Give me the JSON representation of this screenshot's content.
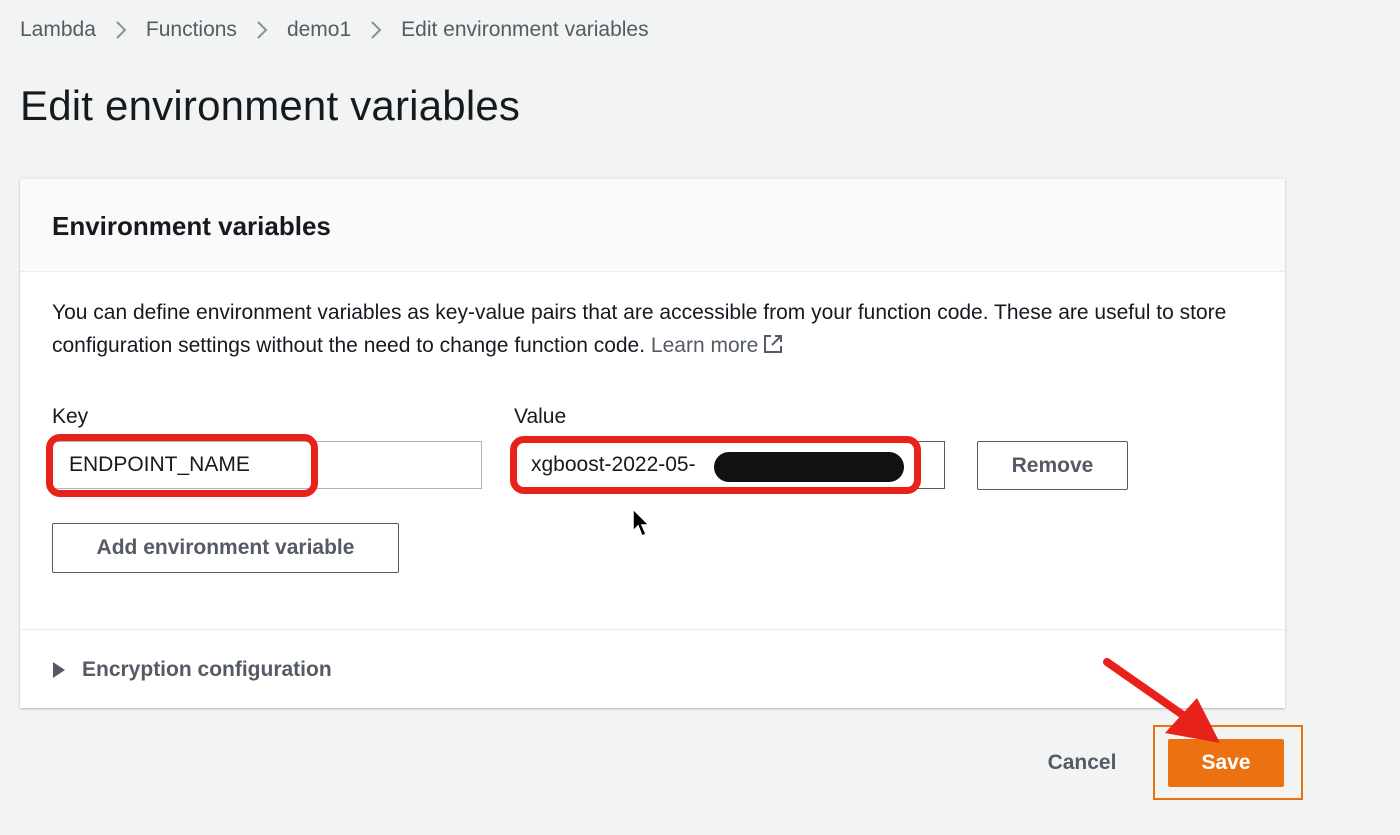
{
  "breadcrumb": {
    "items": [
      "Lambda",
      "Functions",
      "demo1"
    ],
    "current": "Edit environment variables"
  },
  "page": {
    "title": "Edit environment variables"
  },
  "env_panel": {
    "title": "Environment variables",
    "description": "You can define environment variables as key-value pairs that are accessible from your function code. These are useful to store configuration settings without the need to change function code.",
    "learn_more": "Learn more",
    "key_label": "Key",
    "value_label": "Value",
    "variables": [
      {
        "key": "ENDPOINT_NAME",
        "value": "xgboost-2022-05-"
      }
    ],
    "remove_label": "Remove",
    "add_label": "Add environment variable",
    "encryption_label": "Encryption configuration"
  },
  "footer": {
    "cancel_label": "Cancel",
    "save_label": "Save"
  },
  "colors": {
    "primary_button": "#ec7211",
    "annotation_red": "#e8211b",
    "background": "#f2f3f3"
  },
  "icons": [
    "chevron-right-icon",
    "external-link-icon",
    "caret-right-icon",
    "mouse-cursor-icon",
    "annotation-arrow-icon"
  ]
}
